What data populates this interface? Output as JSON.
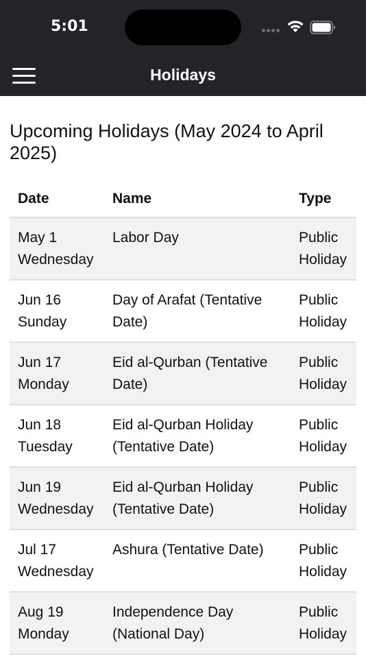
{
  "status": {
    "time": "5:01"
  },
  "nav": {
    "title": "Holidays",
    "menu_icon": "hamburger-menu-icon"
  },
  "page": {
    "heading_line1": "Upcoming Holidays (May 2024 to April",
    "heading_line2": "2025)"
  },
  "table": {
    "headers": {
      "date": "Date",
      "name": "Name",
      "type": "Type"
    },
    "rows": [
      {
        "date": "May 1",
        "day": "Wednesday",
        "name1": "Labor Day",
        "name2": "",
        "type1": "Public",
        "type2": "Holiday"
      },
      {
        "date": "Jun 16",
        "day": "Sunday",
        "name1": "Day of Arafat (Tentative",
        "name2": "Date)",
        "type1": "Public",
        "type2": "Holiday"
      },
      {
        "date": "Jun 17",
        "day": "Monday",
        "name1": "Eid al-Qurban (Tentative",
        "name2": "Date)",
        "type1": "Public",
        "type2": "Holiday"
      },
      {
        "date": "Jun 18",
        "day": "Tuesday",
        "name1": "Eid al-Qurban Holiday",
        "name2": "(Tentative Date)",
        "type1": "Public",
        "type2": "Holiday"
      },
      {
        "date": "Jun 19",
        "day": "Wednesday",
        "name1": "Eid al-Qurban Holiday",
        "name2": "(Tentative Date)",
        "type1": "Public",
        "type2": "Holiday"
      },
      {
        "date": "Jul 17",
        "day": "Wednesday",
        "name1": "Ashura (Tentative Date)",
        "name2": "",
        "type1": "Public",
        "type2": "Holiday"
      },
      {
        "date": "Aug 19",
        "day": "Monday",
        "name1": "Independence Day",
        "name2": "(National Day)",
        "type1": "Public",
        "type2": "Holiday"
      }
    ]
  },
  "colors": {
    "header_bg": "#232428",
    "row_alt_bg": "#f2f2f2",
    "divider": "#dedede"
  }
}
